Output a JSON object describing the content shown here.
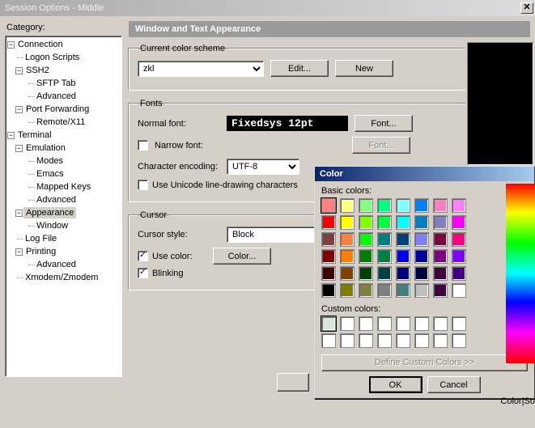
{
  "window": {
    "title": "Session Options - Middle"
  },
  "labels": {
    "category": "Category:"
  },
  "tree": {
    "connection": "Connection",
    "logon_scripts": "Logon Scripts",
    "ssh2": "SSH2",
    "sftp_tab": "SFTP Tab",
    "advanced": "Advanced",
    "port_forwarding": "Port Forwarding",
    "remote_x11": "Remote/X11",
    "terminal": "Terminal",
    "emulation": "Emulation",
    "modes": "Modes",
    "emacs": "Emacs",
    "mapped_keys": "Mapped Keys",
    "e_advanced": "Advanced",
    "appearance": "Appearance",
    "window": "Window",
    "log_file": "Log File",
    "printing": "Printing",
    "p_advanced": "Advanced",
    "xmodem": "Xmodem/Zmodem"
  },
  "section": {
    "header": "Window and Text Appearance"
  },
  "scheme": {
    "legend": "Current color scheme",
    "value": "zkl",
    "edit": "Edit...",
    "new": "New"
  },
  "fonts": {
    "legend": "Fonts",
    "normal_label": "Normal font:",
    "normal_value": "Fixedsys 12pt",
    "font_btn": "Font...",
    "narrow_label": "Narrow font:",
    "encoding_label": "Character encoding:",
    "encoding_value": "UTF-8",
    "unicode_label": "Use Unicode line-drawing characters"
  },
  "cursor": {
    "legend": "Cursor",
    "style_label": "Cursor style:",
    "style_value": "Block",
    "use_color": "Use color:",
    "color_btn": "Color...",
    "blinking": "Blinking"
  },
  "color_dialog": {
    "title": "Color",
    "basic_label": "Basic colors:",
    "custom_label": "Custom colors:",
    "define": "Define Custom Colors >>",
    "ok": "OK",
    "cancel": "Cancel",
    "basic_colors": [
      "#ff8080",
      "#ffff80",
      "#80ff80",
      "#00ff80",
      "#80ffff",
      "#0080ff",
      "#ff80c0",
      "#ff80ff",
      "#ff0000",
      "#ffff00",
      "#80ff00",
      "#00ff40",
      "#00ffff",
      "#0080c0",
      "#8080c0",
      "#ff00ff",
      "#804040",
      "#ff8040",
      "#00ff00",
      "#008080",
      "#004080",
      "#8080ff",
      "#800040",
      "#ff0080",
      "#800000",
      "#ff8000",
      "#008000",
      "#008040",
      "#0000ff",
      "#0000a0",
      "#800080",
      "#8000ff",
      "#400000",
      "#804000",
      "#004000",
      "#004040",
      "#000080",
      "#000040",
      "#400040",
      "#400080",
      "#000000",
      "#808000",
      "#808040",
      "#808080",
      "#408080",
      "#c0c0c0",
      "#400040",
      "#ffffff"
    ],
    "custom_selected": "#d8e8d8"
  },
  "side": {
    "colorso": "Color|So"
  }
}
